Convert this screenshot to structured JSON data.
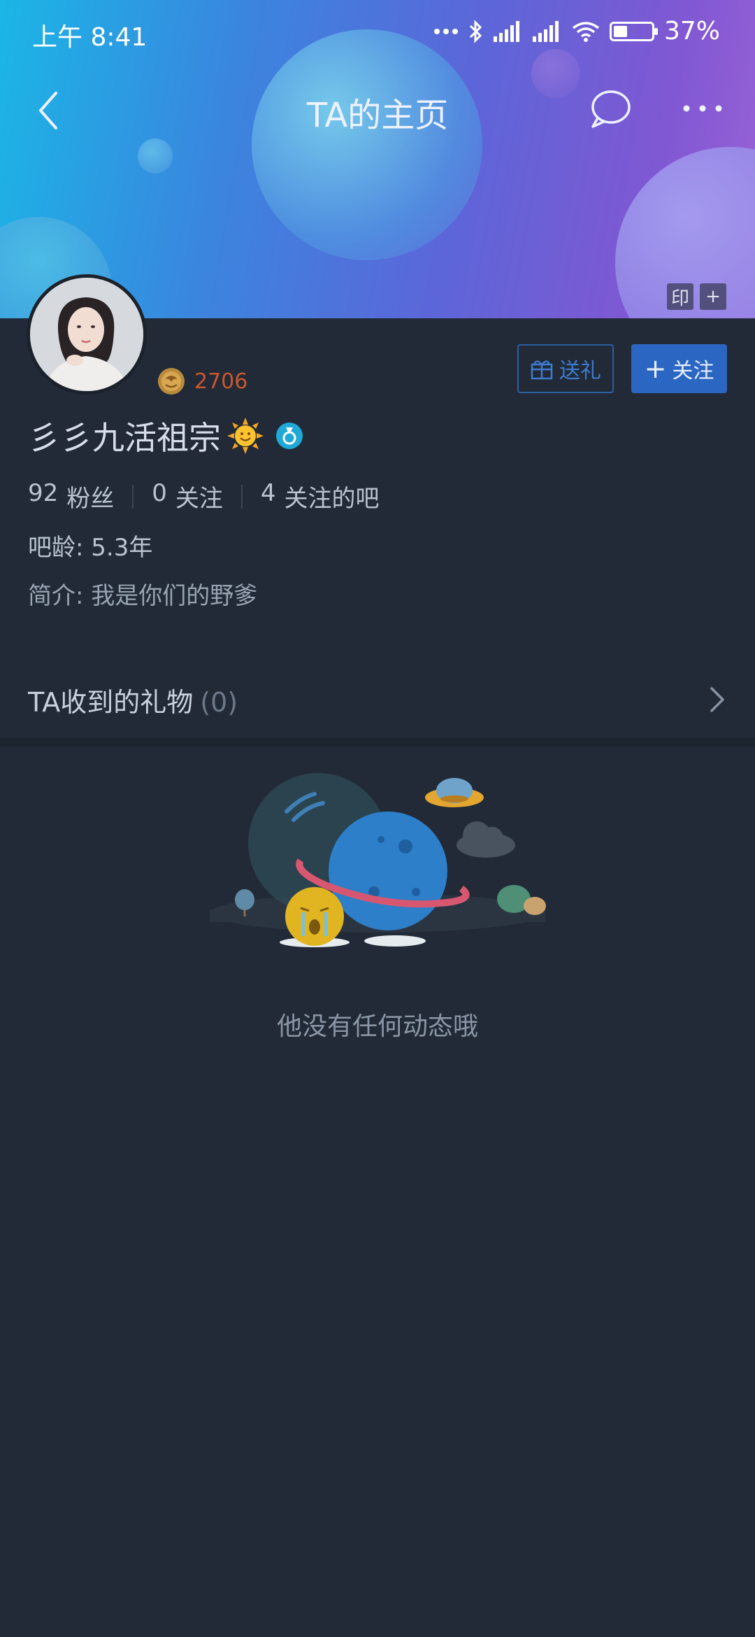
{
  "status_bar": {
    "time": "上午 8:41",
    "battery": "37%",
    "battery_level": 0.37
  },
  "nav": {
    "title": "TA的主页",
    "icons": [
      "back-arrow-icon",
      "chat-icon",
      "more-icon"
    ]
  },
  "banner": {
    "stamp_label": "印",
    "plus_label": "+"
  },
  "profile": {
    "level": "2706",
    "name": "彡彡九活祖宗",
    "gift_button": "送礼",
    "follow_button": "关注",
    "follow_plus": "+",
    "stats": [
      {
        "value": "92",
        "label": "粉丝"
      },
      {
        "value": "0",
        "label": "关注"
      },
      {
        "value": "4",
        "label": "关注的吧"
      }
    ],
    "age": "吧龄: 5.3年",
    "bio": "简介: 我是你们的野爹"
  },
  "gifts": {
    "title": "TA收到的礼物",
    "count": "(0)"
  },
  "empty_state": {
    "text": "他没有任何动态哦"
  },
  "colors": {
    "page_bg": "#212a36",
    "follow_button": "#2a66c2",
    "level_number": "#c9572f",
    "accent_blue": "#3e7bd0"
  }
}
